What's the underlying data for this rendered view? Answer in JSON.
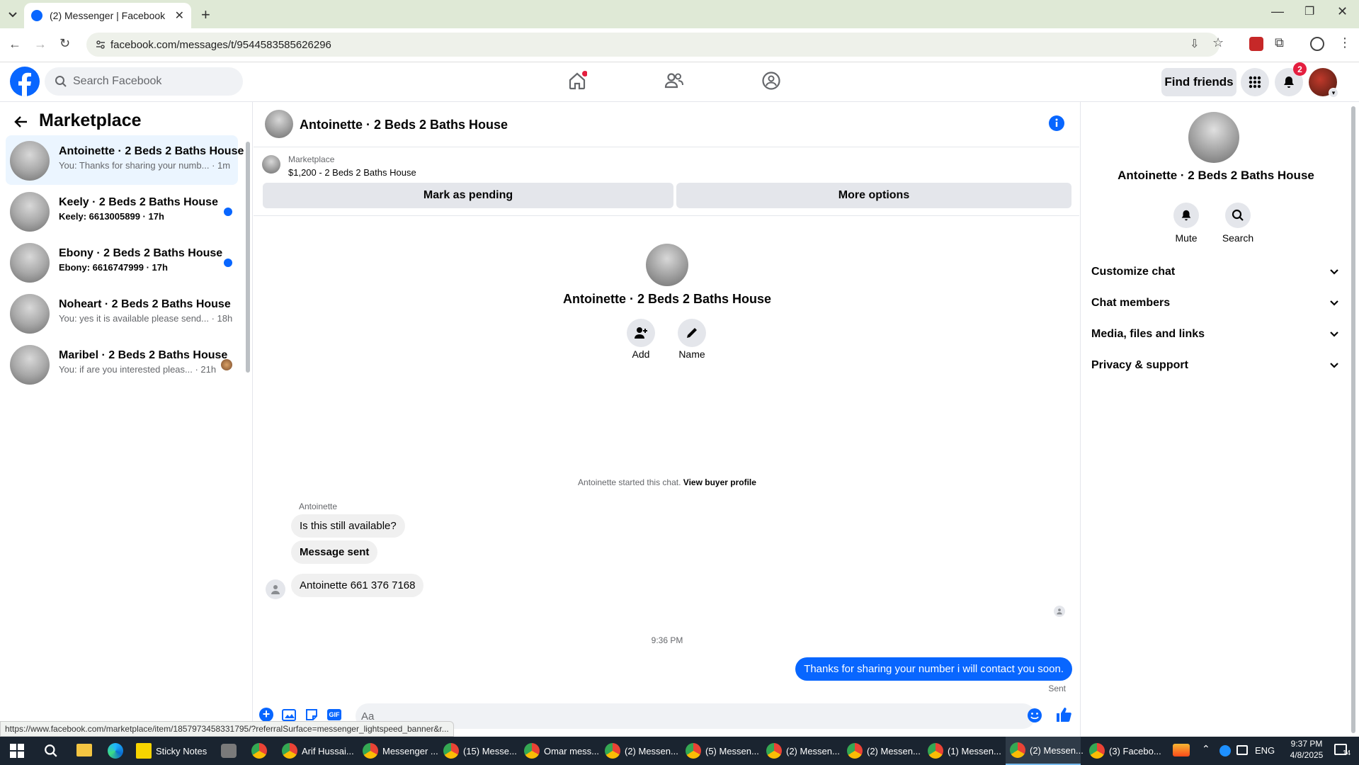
{
  "browser": {
    "tab_title": "(2) Messenger | Facebook",
    "url": "facebook.com/messages/t/9544583585626296",
    "status_url": "https://www.facebook.com/marketplace/item/1857973458331795/?referralSurface=messenger_lightspeed_banner&r..."
  },
  "header": {
    "search_placeholder": "Search Facebook",
    "find_friends": "Find friends",
    "notification_count": "2"
  },
  "sidebar": {
    "title": "Marketplace",
    "conversations": [
      {
        "name": "Antoinette · 2 Beds 2 Baths House",
        "preview": "You: Thanks for sharing your numb... · 1m"
      },
      {
        "name": "Keely · 2 Beds 2 Baths House",
        "preview": "Keely: 6613005899 · 17h"
      },
      {
        "name": "Ebony · 2 Beds 2 Baths House",
        "preview": "Ebony: 6616747999 · 17h"
      },
      {
        "name": "Noheart · 2 Beds 2 Baths House",
        "preview": "You: yes it is available please send... · 18h"
      },
      {
        "name": "Maribel · 2 Beds 2 Baths House",
        "preview": "You: if are you interested pleas... · 21h"
      }
    ]
  },
  "chat": {
    "title": "Antoinette · 2 Beds 2 Baths House",
    "marketplace_label": "Marketplace",
    "listing": "$1,200 - 2 Beds 2 Baths House",
    "mark_pending": "Mark as pending",
    "more_options": "More options",
    "profile_name": "Antoinette · 2 Beds 2 Baths House",
    "add_label": "Add",
    "name_label": "Name",
    "started_text": "Antoinette started this chat.",
    "view_buyer": "View buyer profile",
    "sender_name": "Antoinette",
    "messages_in": [
      "Is this still available?",
      "Message sent",
      "Antoinette 661 376 7168"
    ],
    "time_separator": "9:36 PM",
    "message_out": "Thanks for sharing your number i will contact you soon.",
    "sent_status": "Sent",
    "input_placeholder": "Aa"
  },
  "details": {
    "name": "Antoinette · 2 Beds 2 Baths House",
    "mute": "Mute",
    "search": "Search",
    "sections": [
      "Customize chat",
      "Chat members",
      "Media, files and links",
      "Privacy & support"
    ]
  },
  "taskbar": {
    "items": [
      "Sticky Notes",
      "Arif Hussai...",
      "Messenger ...",
      "(15) Messe...",
      "Omar mess...",
      "(2) Messen...",
      "(5) Messen...",
      "(2) Messen...",
      "(2) Messen...",
      "(1) Messen...",
      "(2) Messen...",
      "(3) Facebo..."
    ],
    "lang": "ENG",
    "time": "9:37 PM",
    "date": "4/8/2025",
    "notif_count": "14"
  },
  "colors": {
    "accent": "#0866ff",
    "tabbar": "#dfe9d6",
    "taskbar": "#1a2430"
  }
}
